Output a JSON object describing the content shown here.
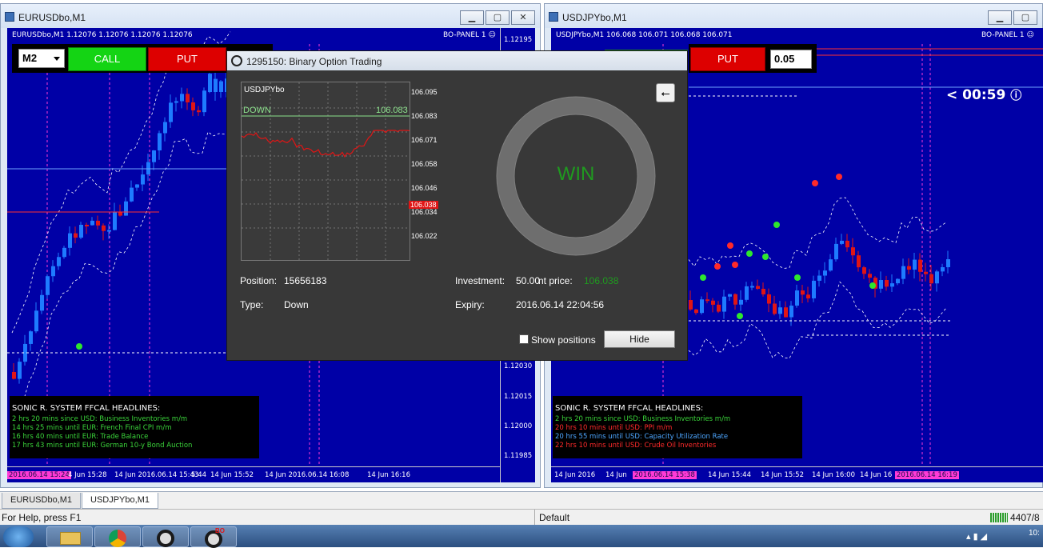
{
  "left_window": {
    "title": "EURUSDbo,M1",
    "chart_header": "EURUSDbo,M1  1.12076 1.12076 1.12076 1.12076",
    "bo_panel": "BO-PANEL 1",
    "timeframe": "M2",
    "call_label": "CALL",
    "put_label": "PUT",
    "price_scale": [
      "1.12195",
      "1.12030",
      "1.12015",
      "1.12000",
      "1.11985"
    ],
    "time_axis": [
      {
        "text": "2016.06.14 15:24",
        "highlight": true
      },
      {
        "text": "4 Jun 15:28",
        "highlight": false
      },
      {
        "text": "14 Jun 2016.06.14 15:43",
        "highlight": true
      },
      {
        "text": "5:44",
        "highlight": false
      },
      {
        "text": "14 Jun 15:52",
        "highlight": false
      },
      {
        "text": "14 Jun 2016.06.14 16:08",
        "highlight": true
      },
      {
        "text": "14 Jun 16:16",
        "highlight": false
      }
    ],
    "headlines_title": "SONIC R. SYSTEM  FFCAL HEADLINES:",
    "headlines": [
      {
        "text": "2 hrs 20 mins since USD: Business Inventories m/m",
        "color": "#3ad43a"
      },
      {
        "text": "14 hrs 25 mins until EUR: French Final CPI m/m",
        "color": "#3ad43a"
      },
      {
        "text": "16 hrs 40 mins until EUR: Trade Balance",
        "color": "#3ad43a"
      },
      {
        "text": "17 hrs 43 mins until EUR: German 10-y Bond Auction",
        "color": "#3ad43a"
      }
    ]
  },
  "right_window": {
    "title": "USDJPYbo,M1",
    "chart_header": "USDJPYbo,M1  106.068 106.071 106.068 106.071",
    "bo_panel": "BO-PANEL 1",
    "put_label": "PUT",
    "amount": "0.05",
    "timer": "< 00:59",
    "time_axis": [
      {
        "text": "14 Jun 2016",
        "highlight": false
      },
      {
        "text": "14 Jun",
        "highlight": false
      },
      {
        "text": "2016.06.14 15:38",
        "highlight": true
      },
      {
        "text": "14 Jun 15:44",
        "highlight": false
      },
      {
        "text": "14 Jun 15:52",
        "highlight": false
      },
      {
        "text": "14 Jun 16:00",
        "highlight": false
      },
      {
        "text": "14 Jun 16",
        "highlight": false
      },
      {
        "text": "2016.06.14 16:19",
        "highlight": true
      }
    ],
    "headlines_title": "SONIC R. SYSTEM  FFCAL HEADLINES:",
    "headlines": [
      {
        "text": "2 hrs 20 mins since USD: Business Inventories m/m",
        "color": "#3ad43a"
      },
      {
        "text": "20 hrs 10 mins until USD: PPI m/m",
        "color": "#ff2a2a"
      },
      {
        "text": "20 hrs 55 mins until USD: Capacity Utilization Rate",
        "color": "#4da6ff"
      },
      {
        "text": "22 hrs 10 mins until USD: Crude Oil Inventories",
        "color": "#ff2a2a"
      }
    ]
  },
  "dialog": {
    "title": "1295150: Binary Option Trading",
    "symbol": "USDJPYbo",
    "direction": "DOWN",
    "open_price": "106.083",
    "current_tag": "106.038",
    "scale": [
      "106.095",
      "106.083",
      "106.071",
      "106.058",
      "106.046",
      "106.034",
      "106.022"
    ],
    "result": "WIN",
    "position_label": "Position:",
    "position_value": "15656183",
    "type_label": "Type:",
    "type_value": "Down",
    "investment_label": "Investment:",
    "investment_value": "50.00",
    "current_price_label": "nt price:",
    "current_price_value": "106.038",
    "expiry_label": "Expiry:",
    "expiry_value": "2016.06.14 22:04:56",
    "show_positions_label": "Show positions",
    "hide_label": "Hide",
    "back_icon": "arrow-left-circle-icon"
  },
  "tabs": [
    {
      "label": "EURUSDbo,M1",
      "active": false
    },
    {
      "label": "USDJPYbo,M1",
      "active": true
    }
  ],
  "status": {
    "help": "For Help, press F1",
    "profile": "Default",
    "connection": "4407/8"
  },
  "taskbar": {
    "clock": "10:"
  },
  "colors": {
    "chart_bg": "#0000a6",
    "bull": "#1e7bff",
    "bear": "#e01515",
    "accent_magenta": "#ff3ad7",
    "win_green": "#1f9a1f"
  }
}
